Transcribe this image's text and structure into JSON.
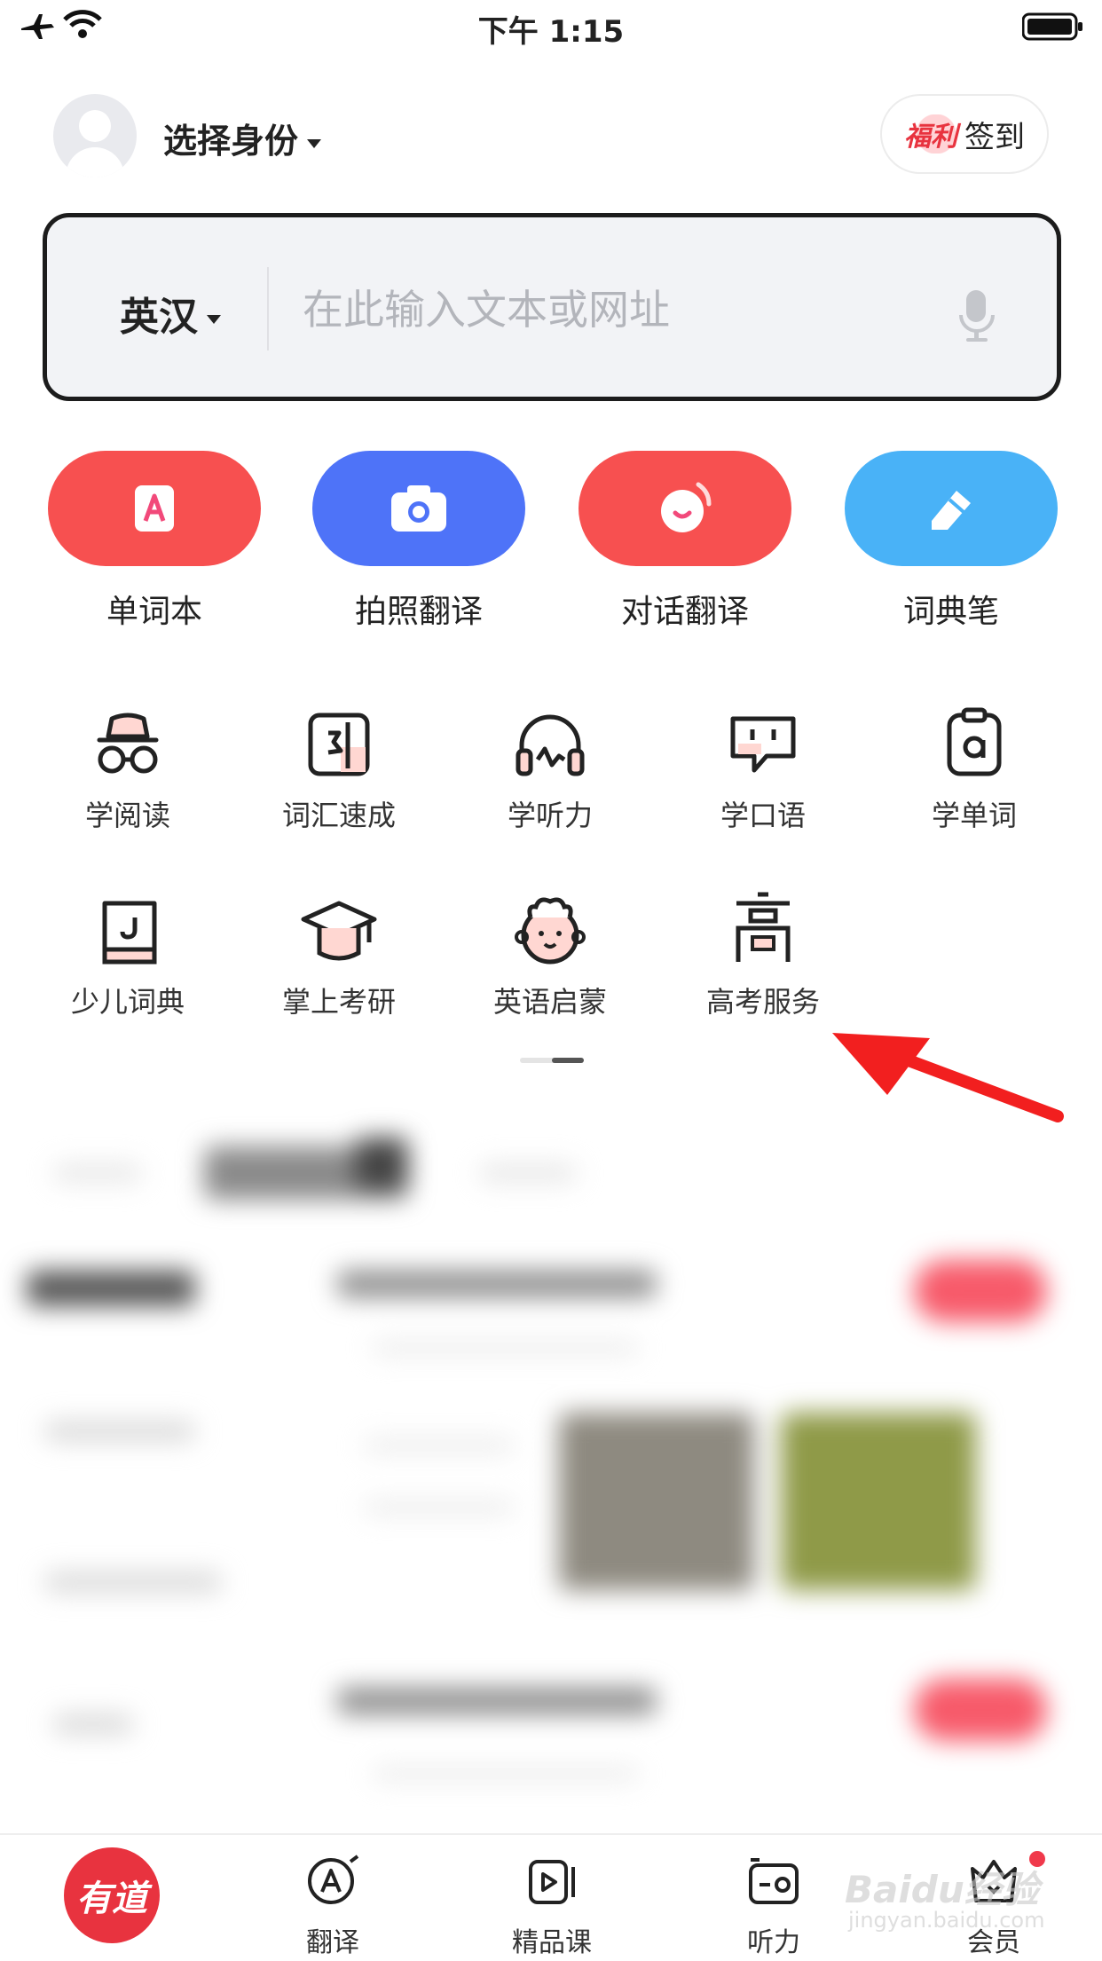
{
  "status_bar": {
    "time": "下午 1:15"
  },
  "header": {
    "identity": "选择身份",
    "welfare": "福利",
    "signin": "签到"
  },
  "search": {
    "lang": "英汉",
    "placeholder": "在此输入文本或网址"
  },
  "quick_actions": [
    {
      "label": "单词本",
      "color": "#f75050",
      "icon": "wordbook-icon"
    },
    {
      "label": "拍照翻译",
      "color": "#4e73f8",
      "icon": "camera-icon"
    },
    {
      "label": "对话翻译",
      "color": "#f75050",
      "icon": "dialogue-icon"
    },
    {
      "label": "词典笔",
      "color": "#49b2f7",
      "icon": "pen-icon"
    }
  ],
  "services": [
    {
      "label": "学阅读",
      "icon": "reading-icon"
    },
    {
      "label": "词汇速成",
      "icon": "vocabulary-icon"
    },
    {
      "label": "学听力",
      "icon": "headphones-icon"
    },
    {
      "label": "学口语",
      "icon": "speaking-icon"
    },
    {
      "label": "学单词",
      "icon": "words-icon"
    },
    {
      "label": "少儿词典",
      "icon": "kids-dictionary-icon"
    },
    {
      "label": "掌上考研",
      "icon": "graduation-cap-icon"
    },
    {
      "label": "英语启蒙",
      "icon": "baby-face-icon"
    },
    {
      "label": "高考服务",
      "icon": "gaokao-icon"
    }
  ],
  "tabbar": {
    "home": "有道",
    "items": [
      {
        "label": "翻译",
        "icon": "translate-icon"
      },
      {
        "label": "精品课",
        "icon": "course-icon"
      },
      {
        "label": "听力",
        "icon": "listening-icon"
      },
      {
        "label": "会员",
        "icon": "crown-icon"
      }
    ]
  },
  "watermark": {
    "brand": "Baidu经验",
    "url": "jingyan.baidu.com"
  }
}
